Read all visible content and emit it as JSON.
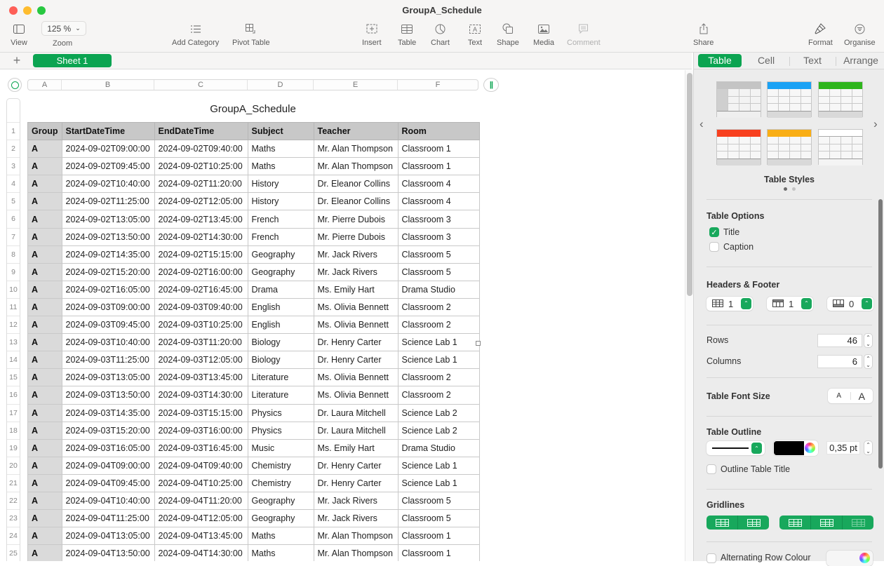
{
  "window": {
    "title": "GroupA_Schedule"
  },
  "toolbar": {
    "view_label": "View",
    "zoom_value": "125 %",
    "zoom_label": "Zoom",
    "add_category_label": "Add Category",
    "pivot_table_label": "Pivot Table",
    "insert_label": "Insert",
    "table_label": "Table",
    "chart_label": "Chart",
    "text_label": "Text",
    "shape_label": "Shape",
    "media_label": "Media",
    "comment_label": "Comment",
    "share_label": "Share",
    "format_label": "Format",
    "organise_label": "Organise"
  },
  "sheets": {
    "add_label": "+",
    "tabs": [
      {
        "label": "Sheet 1",
        "active": true
      }
    ]
  },
  "spreadsheet": {
    "column_letters": [
      "A",
      "B",
      "C",
      "D",
      "E",
      "F"
    ],
    "freeze_handle": "||",
    "table_title": "GroupA_Schedule",
    "row_numbers": [
      "1",
      "2",
      "3",
      "4",
      "5",
      "6",
      "7",
      "8",
      "9",
      "10",
      "11",
      "12",
      "13",
      "14",
      "15",
      "16",
      "17",
      "18",
      "19",
      "20",
      "21",
      "22",
      "23",
      "24",
      "25"
    ],
    "headers": [
      "Group",
      "StartDateTime",
      "EndDateTime",
      "Subject",
      "Teacher",
      "Room"
    ],
    "rows": [
      [
        "A",
        "2024-09-02T09:00:00",
        "2024-09-02T09:40:00",
        "Maths",
        "Mr. Alan Thompson",
        "Classroom 1"
      ],
      [
        "A",
        "2024-09-02T09:45:00",
        "2024-09-02T10:25:00",
        "Maths",
        "Mr. Alan Thompson",
        "Classroom 1"
      ],
      [
        "A",
        "2024-09-02T10:40:00",
        "2024-09-02T11:20:00",
        "History",
        "Dr. Eleanor Collins",
        "Classroom 4"
      ],
      [
        "A",
        "2024-09-02T11:25:00",
        "2024-09-02T12:05:00",
        "History",
        "Dr. Eleanor Collins",
        "Classroom 4"
      ],
      [
        "A",
        "2024-09-02T13:05:00",
        "2024-09-02T13:45:00",
        "French",
        "Mr. Pierre Dubois",
        "Classroom 3"
      ],
      [
        "A",
        "2024-09-02T13:50:00",
        "2024-09-02T14:30:00",
        "French",
        "Mr. Pierre Dubois",
        "Classroom 3"
      ],
      [
        "A",
        "2024-09-02T14:35:00",
        "2024-09-02T15:15:00",
        "Geography",
        "Mr. Jack Rivers",
        "Classroom 5"
      ],
      [
        "A",
        "2024-09-02T15:20:00",
        "2024-09-02T16:00:00",
        "Geography",
        "Mr. Jack Rivers",
        "Classroom 5"
      ],
      [
        "A",
        "2024-09-02T16:05:00",
        "2024-09-02T16:45:00",
        "Drama",
        "Ms. Emily Hart",
        "Drama Studio"
      ],
      [
        "A",
        "2024-09-03T09:00:00",
        "2024-09-03T09:40:00",
        "English",
        "Ms. Olivia Bennett",
        "Classroom 2"
      ],
      [
        "A",
        "2024-09-03T09:45:00",
        "2024-09-03T10:25:00",
        "English",
        "Ms. Olivia Bennett",
        "Classroom 2"
      ],
      [
        "A",
        "2024-09-03T10:40:00",
        "2024-09-03T11:20:00",
        "Biology",
        "Dr. Henry Carter",
        "Science Lab 1"
      ],
      [
        "A",
        "2024-09-03T11:25:00",
        "2024-09-03T12:05:00",
        "Biology",
        "Dr. Henry Carter",
        "Science Lab 1"
      ],
      [
        "A",
        "2024-09-03T13:05:00",
        "2024-09-03T13:45:00",
        "Literature",
        "Ms. Olivia Bennett",
        "Classroom 2"
      ],
      [
        "A",
        "2024-09-03T13:50:00",
        "2024-09-03T14:30:00",
        "Literature",
        "Ms. Olivia Bennett",
        "Classroom 2"
      ],
      [
        "A",
        "2024-09-03T14:35:00",
        "2024-09-03T15:15:00",
        "Physics",
        "Dr. Laura Mitchell",
        "Science Lab 2"
      ],
      [
        "A",
        "2024-09-03T15:20:00",
        "2024-09-03T16:00:00",
        "Physics",
        "Dr. Laura Mitchell",
        "Science Lab 2"
      ],
      [
        "A",
        "2024-09-03T16:05:00",
        "2024-09-03T16:45:00",
        "Music",
        "Ms. Emily Hart",
        "Drama Studio"
      ],
      [
        "A",
        "2024-09-04T09:00:00",
        "2024-09-04T09:40:00",
        "Chemistry",
        "Dr. Henry Carter",
        "Science Lab 1"
      ],
      [
        "A",
        "2024-09-04T09:45:00",
        "2024-09-04T10:25:00",
        "Chemistry",
        "Dr. Henry Carter",
        "Science Lab 1"
      ],
      [
        "A",
        "2024-09-04T10:40:00",
        "2024-09-04T11:20:00",
        "Geography",
        "Mr. Jack Rivers",
        "Classroom 5"
      ],
      [
        "A",
        "2024-09-04T11:25:00",
        "2024-09-04T12:05:00",
        "Geography",
        "Mr. Jack Rivers",
        "Classroom 5"
      ],
      [
        "A",
        "2024-09-04T13:05:00",
        "2024-09-04T13:45:00",
        "Maths",
        "Mr. Alan Thompson",
        "Classroom 1"
      ],
      [
        "A",
        "2024-09-04T13:50:00",
        "2024-09-04T14:30:00",
        "Maths",
        "Mr. Alan Thompson",
        "Classroom 1"
      ]
    ]
  },
  "inspector": {
    "tabs": [
      {
        "label": "Table",
        "active": true
      },
      {
        "label": "Cell",
        "active": false
      },
      {
        "label": "Text",
        "active": false
      },
      {
        "label": "Arrange",
        "active": false
      }
    ],
    "table_styles_label": "Table Styles",
    "table_style_colors": [
      "#c4c4c4",
      "#1aa2f5",
      "#2eb51c",
      "#f8401f",
      "#f9ae15",
      "#ffffff"
    ],
    "table_options": {
      "title": "Table Options",
      "title_checkbox_label": "Title",
      "title_checked": true,
      "caption_checkbox_label": "Caption",
      "caption_checked": false
    },
    "headers_footer": {
      "title": "Headers & Footer",
      "header_rows": "1",
      "header_columns": "1",
      "footer_rows": "0"
    },
    "rows_label": "Rows",
    "rows_value": "46",
    "columns_label": "Columns",
    "columns_value": "6",
    "font_size": {
      "label": "Table Font Size",
      "smaller": "A",
      "larger": "A"
    },
    "outline": {
      "title": "Table Outline",
      "color": "#000000",
      "width_value": "0,35 pt",
      "outline_title_label": "Outline Table Title",
      "outline_title_checked": false
    },
    "gridlines_title": "Gridlines",
    "alternating_row_label": "Alternating Row Colour",
    "alternating_row_checked": false
  }
}
